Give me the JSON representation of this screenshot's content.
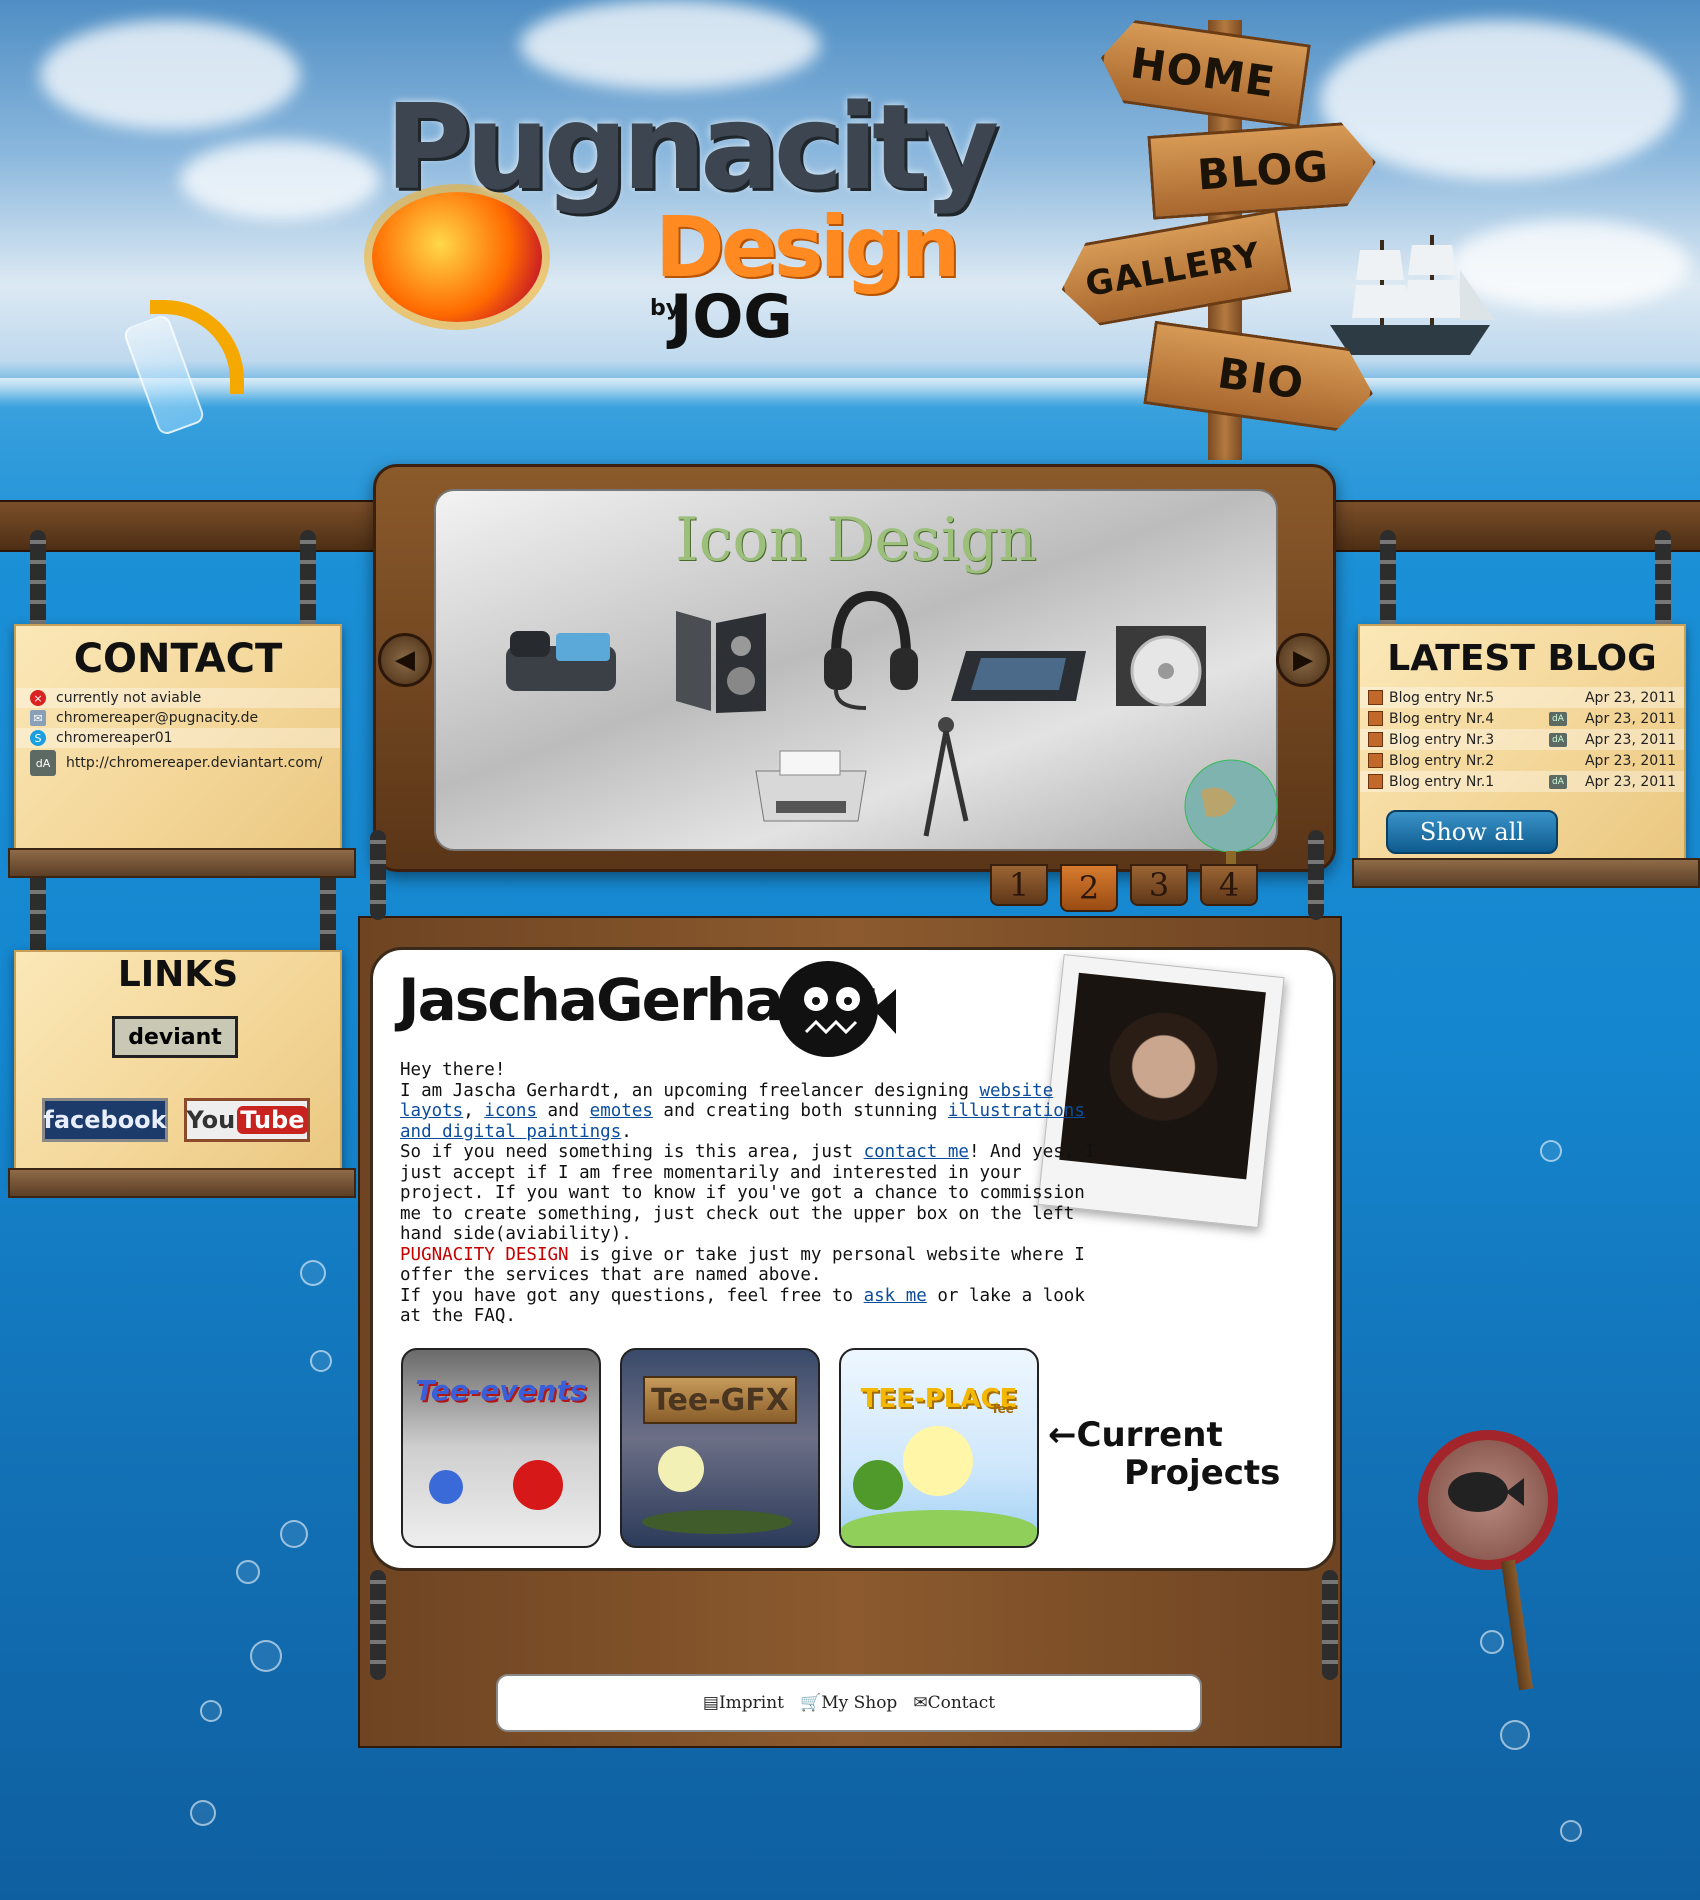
{
  "nav": {
    "home": "HOME",
    "blog": "BLOG",
    "gallery": "GALLERY",
    "bio": "BIO"
  },
  "logo": {
    "main": "Pugnacity",
    "sub": "Design",
    "by": "by",
    "author_mark": "JOG"
  },
  "contact": {
    "title": "CONTACT",
    "items": [
      {
        "icon": "status-offline-icon",
        "text": "currently not aviable"
      },
      {
        "icon": "mail-icon",
        "text": "chromereaper@pugnacity.de"
      },
      {
        "icon": "skype-icon",
        "text": "chromereaper01"
      },
      {
        "icon": "deviantart-icon",
        "text": "http://chromereaper.deviantart.com/"
      }
    ]
  },
  "links": {
    "title": "LINKS",
    "deviant": "deviant",
    "facebook": "facebook",
    "youtube_you": "You",
    "youtube_tube": "Tube"
  },
  "slider": {
    "title": "Icon Design",
    "pages": [
      "1",
      "2",
      "3",
      "4"
    ],
    "active_page": "2"
  },
  "blog": {
    "title": "LATEST BLOG",
    "entries": [
      {
        "title": "Blog entry Nr.5",
        "date": "Apr 23, 2011"
      },
      {
        "title": "Blog entry Nr.4",
        "date": "Apr 23, 2011"
      },
      {
        "title": "Blog entry Nr.3",
        "date": "Apr 23, 2011"
      },
      {
        "title": "Blog entry Nr.2",
        "date": "Apr 23, 2011"
      },
      {
        "title": "Blog entry Nr.1",
        "date": "Apr 23, 2011"
      }
    ],
    "show_all": "Show all"
  },
  "bio": {
    "name": "JaschaGerhardt",
    "greeting": "Hey there!",
    "p1_a": "I am Jascha Gerhardt, an upcoming freelancer designing ",
    "link_website_layouts": "website layots",
    "p1_b": ", ",
    "link_icons": "icons",
    "p1_c": " and ",
    "link_emotes": "emotes",
    "p1_d": " and creating both stunning ",
    "link_illustrations": "illustrations and digital paintings",
    "p1_e": ".",
    "p2_a": "So if you need something is this area, just ",
    "link_contact_me": "contact me",
    "p2_b": "! And yes, I just accept if I am free momentarily and interested in your project. If you want to know if you've got a chance to commission me to create something, just check out the upper box on the left hand side(aviability).",
    "brand": "PUGNACITY DESIGN",
    "p3": " is give or take just my personal website where I offer the services that are named above.",
    "p4_a": "If you have got any questions, feel free to ",
    "link_ask_me": "ask me",
    "p4_b": " or lake a look at the FAQ."
  },
  "projects": {
    "items": [
      "Tee-events",
      "Tee-GFX",
      "TEE-PLACE"
    ],
    "tee_place_badge": "Tee",
    "label_line1": "←Current",
    "label_line2": "Projects"
  },
  "footer": {
    "imprint": "Imprint",
    "shop": "My Shop",
    "contact": "Contact"
  }
}
